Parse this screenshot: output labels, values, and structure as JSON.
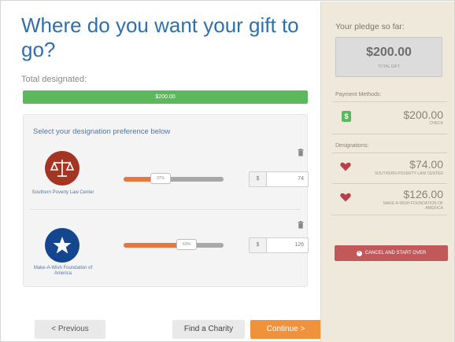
{
  "main": {
    "title": "Where do you want your gift to go?",
    "total_label": "Total designated:",
    "progress_text": "$200.00",
    "progress_fraction": 1.0,
    "panel_heading": "Select your designation preference below",
    "charities": [
      {
        "name": "Southern Poverty Law Center",
        "slider_label": "37%",
        "slider_fraction": 0.37,
        "currency": "$",
        "amount": "74",
        "logo_color": "#a33522",
        "icon": "scales-of-justice-icon"
      },
      {
        "name": "Make-A-Wish Foundation of America",
        "slider_label": "63%",
        "slider_fraction": 0.63,
        "currency": "$",
        "amount": "126",
        "logo_color": "#14458f",
        "icon": "star-icon"
      }
    ],
    "buttons": {
      "previous": "< Previous",
      "find": "Find a Charity",
      "continue": "Continue >"
    }
  },
  "sidebar": {
    "pledge_label": "Your pledge so far:",
    "pledge_amount": "$200.00",
    "pledge_sub": "TOTAL GIFT",
    "payment_label": "Payment Methods:",
    "payment_icon": "$",
    "payment_amount": "$200.00",
    "payment_sub": "CHECK",
    "designations_label": "Designations:",
    "designations": [
      {
        "amount": "$74.00",
        "name": "SOUTHERN POVERTY LAW CENTER"
      },
      {
        "amount": "$126.00",
        "name": "MAKE-A-WISH FOUNDATION OF AMERICA"
      }
    ],
    "cancel_label": "CANCEL AND START OVER"
  },
  "colors": {
    "accent_blue": "#2f6fae",
    "progress_green": "#5cb85c",
    "slider_orange": "#e8773c",
    "continue_orange": "#f0923c",
    "cancel_red": "#c1585a",
    "heart_red": "#b8404a",
    "sidebar_bg": "#efe9dc"
  }
}
